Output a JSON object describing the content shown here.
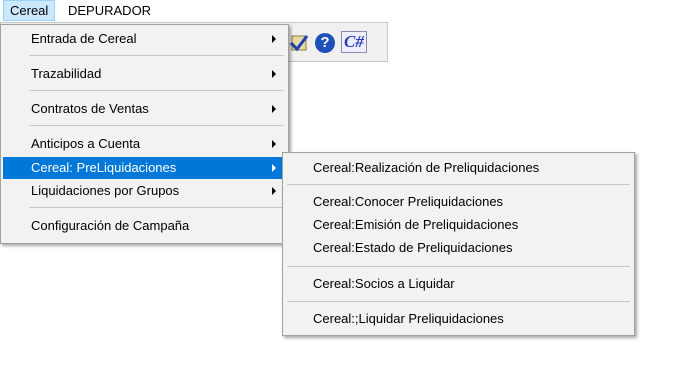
{
  "menubar": {
    "items": [
      "Cereal",
      "DEPURADOR"
    ]
  },
  "toolbar": {
    "help_glyph": "?",
    "csharp_label": "C#"
  },
  "main_menu": {
    "items": [
      "Entrada de Cereal",
      "Trazabilidad",
      "Contratos de Ventas",
      "Anticipos a Cuenta",
      "Cereal: PreLiquidaciones",
      "Liquidaciones por Grupos",
      "Configuración de Campaña"
    ],
    "highlighted": "Cereal: PreLiquidaciones"
  },
  "submenu": {
    "items": [
      "Cereal:Realización de Preliquidaciones",
      "Cereal:Conocer Preliquidaciones",
      "Cereal:Emisión de Preliquidaciones",
      "Cereal:Estado de Preliquidaciones",
      "Cereal:Socios a Liquidar",
      "Cereal:;Liquidar Preliquidaciones"
    ]
  },
  "colors": {
    "highlight": "#0078d7",
    "menu_bg": "#f2f2f2",
    "menubar_active": "#cce8ff"
  }
}
